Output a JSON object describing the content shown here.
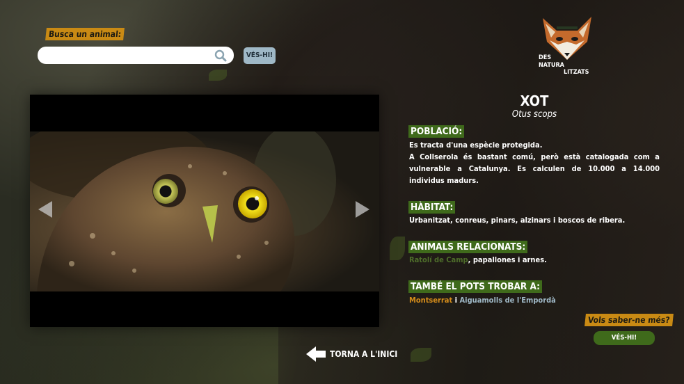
{
  "search": {
    "label": "Busca un animal:",
    "placeholder": "",
    "value": "",
    "button_label": "VÉS-HI!"
  },
  "logo": {
    "line1": "DES",
    "line2": "NATURA",
    "line3": "LITZATS"
  },
  "species": {
    "name": "XOT",
    "scientific": "Otus scops"
  },
  "sections": {
    "poblacio": {
      "heading": "POBLACIÓ:",
      "p1": "Es tracta d'una espècie protegida.",
      "p2": "A Collserola és bastant comú, però està catalogada com a vulnerable a Catalunya. Es calculen de 10.000 a 14.000 individus madurs."
    },
    "habitat": {
      "heading": "HÀBITAT:",
      "text": "Urbanitzat, conreus, pinars, alzinars i boscos de ribera."
    },
    "related": {
      "heading": "ANIMALS RELACIONATS:",
      "link": "Ratolí de Camp",
      "rest": ", papallones i arnes."
    },
    "where": {
      "heading": "TAMBÉ EL POTS TROBAR A:",
      "link1": "Montserrat",
      "separator": "i",
      "link2": "Aiguamolls de l'Empordà"
    }
  },
  "more": {
    "label": "Vols saber-ne més?",
    "button_label": "VÉS-HI!"
  },
  "back": {
    "label": "TORNA A L'INICI"
  },
  "colors": {
    "accent_orange": "#c98a14",
    "accent_green": "#3f6a1b",
    "button_blue": "#9fb8c6"
  }
}
